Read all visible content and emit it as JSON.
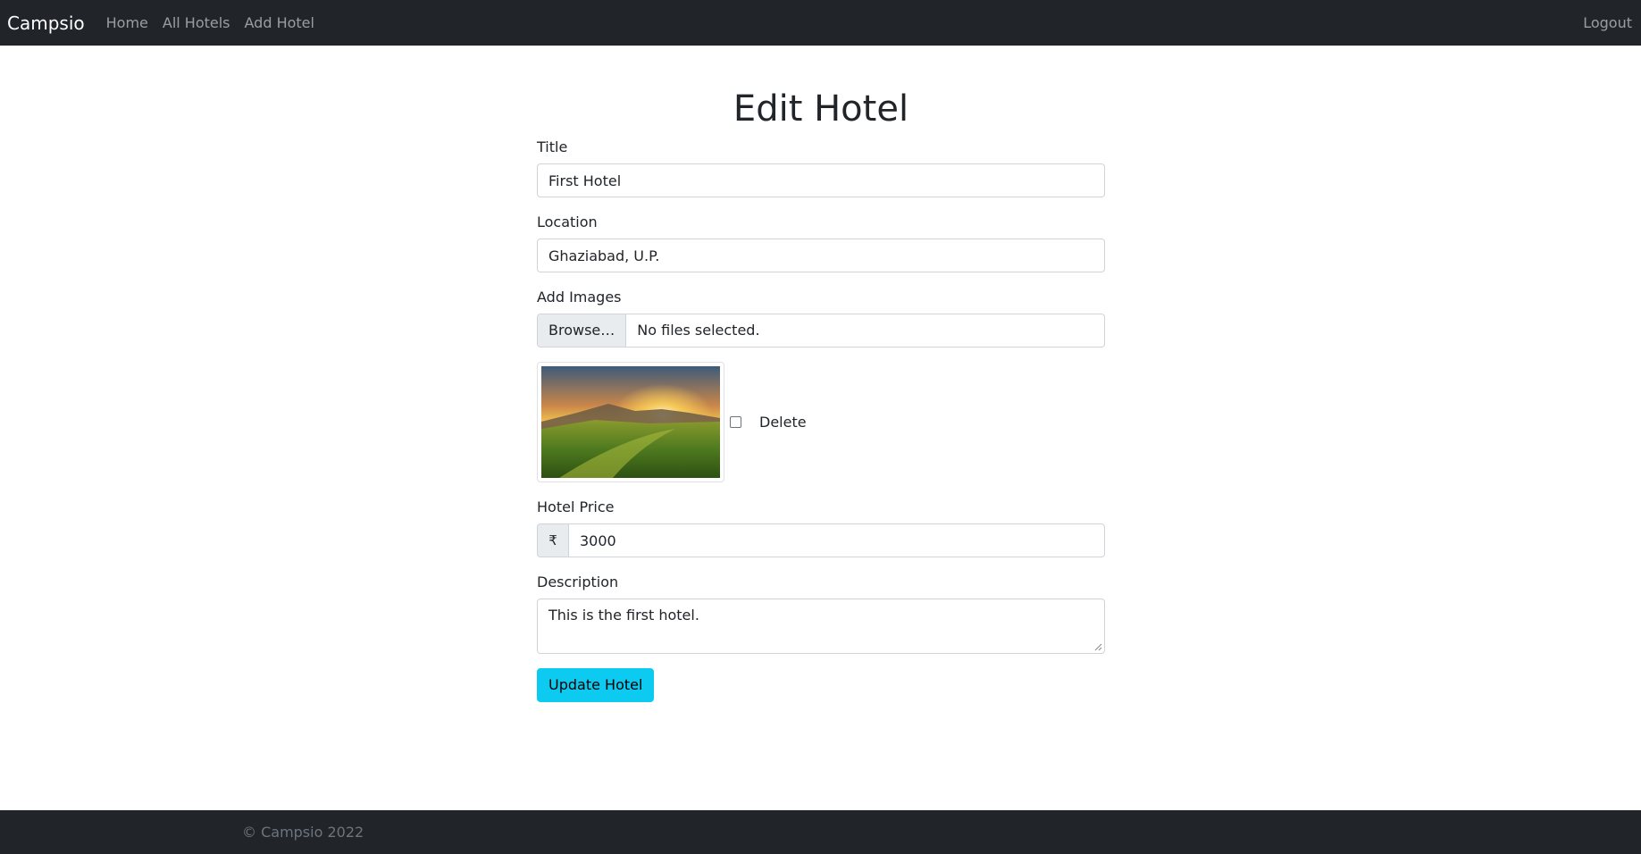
{
  "navbar": {
    "brand": "Campsio",
    "links": [
      "Home",
      "All Hotels",
      "Add Hotel"
    ],
    "logout": "Logout"
  },
  "page": {
    "title": "Edit Hotel"
  },
  "form": {
    "title_label": "Title",
    "title_value": "First Hotel",
    "location_label": "Location",
    "location_value": "Ghaziabad, U.P.",
    "images_label": "Add Images",
    "browse_label": "Browse…",
    "file_status": "No files selected.",
    "delete_label": "Delete",
    "price_label": "Hotel Price",
    "currency_symbol": "₹",
    "price_value": "3000",
    "description_label": "Description",
    "description_value": "This is the first hotel.",
    "submit_label": "Update Hotel"
  },
  "footer": {
    "text": "© Campsio 2022"
  },
  "colors": {
    "navbar_bg": "#212529",
    "button_bg": "#0dcaf0"
  }
}
